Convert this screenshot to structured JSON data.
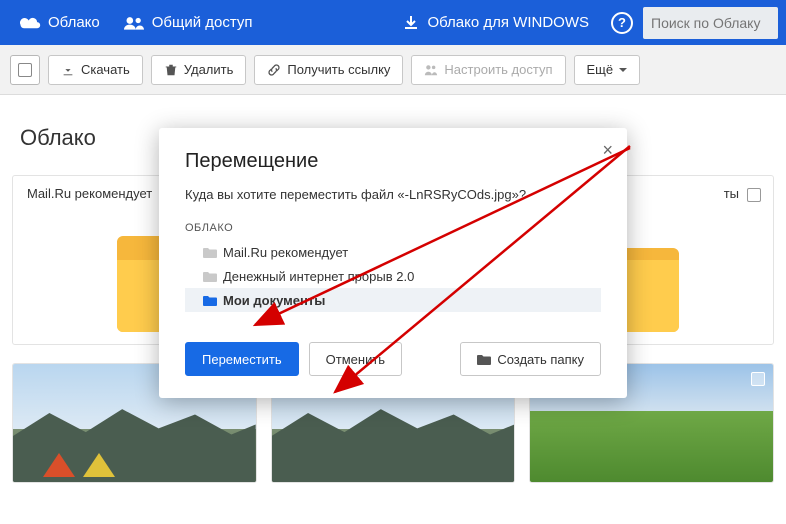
{
  "header": {
    "cloud": "Облако",
    "shared": "Общий доступ",
    "windows": "Облако для WINDOWS",
    "search_placeholder": "Поиск по Облаку"
  },
  "toolbar": {
    "download": "Скачать",
    "delete": "Удалить",
    "get_link": "Получить ссылку",
    "share": "Настроить доступ",
    "more": "Ещё"
  },
  "page": {
    "title": "Облако",
    "folder1": "Mail.Ru рекомендует",
    "folder2_suffix": "ты"
  },
  "modal": {
    "title": "Перемещение",
    "question": "Куда вы хотите переместить файл «-LnRSRyCOds.jpg»?",
    "tree_head": "ОБЛАКО",
    "items": [
      "Mail.Ru рекомендует",
      "Денежный интернет прорыв 2.0",
      "Мои документы"
    ],
    "move": "Переместить",
    "cancel": "Отменить",
    "create_folder": "Создать папку"
  }
}
